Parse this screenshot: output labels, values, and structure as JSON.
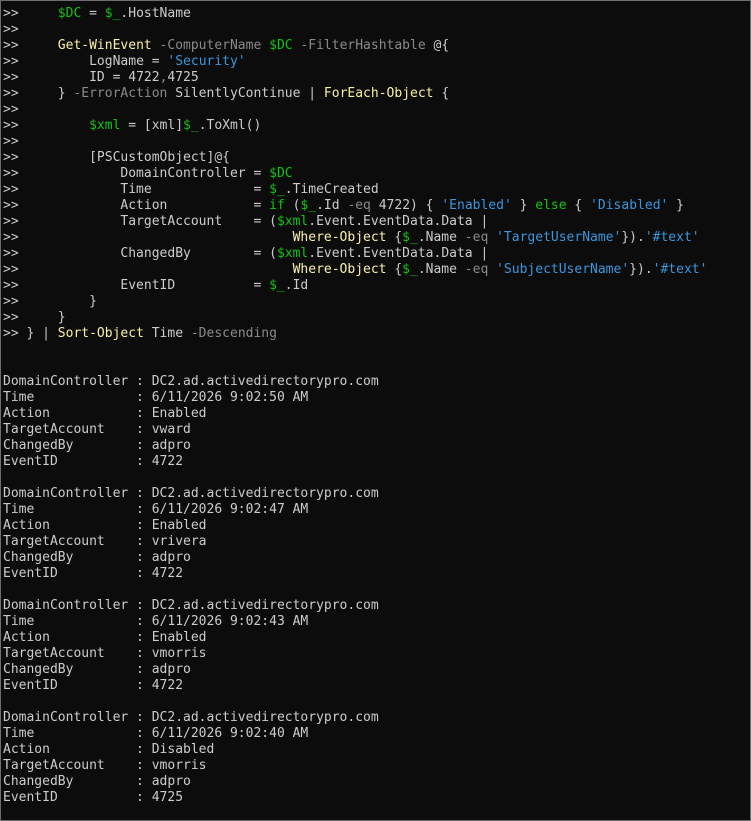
{
  "terminal": {
    "prompt": ">>",
    "code_lines": [
      {
        "indent": "     ",
        "tokens": [
          [
            "var",
            "$DC"
          ],
          [
            "txt",
            " = "
          ],
          [
            "var",
            "$_"
          ],
          [
            "txt",
            ".HostName"
          ]
        ]
      },
      {
        "indent": "",
        "tokens": []
      },
      {
        "indent": "     ",
        "tokens": [
          [
            "cmd",
            "Get-WinEvent"
          ],
          [
            "param",
            " -ComputerName "
          ],
          [
            "var",
            "$DC"
          ],
          [
            "param",
            " -FilterHashtable "
          ],
          [
            "txt",
            "@{"
          ]
        ]
      },
      {
        "indent": "         ",
        "tokens": [
          [
            "txt",
            "LogName = "
          ],
          [
            "str",
            "'Security'"
          ]
        ]
      },
      {
        "indent": "         ",
        "tokens": [
          [
            "txt",
            "ID = 4722"
          ],
          [
            "param",
            ","
          ],
          [
            "txt",
            "4725"
          ]
        ]
      },
      {
        "indent": "     ",
        "tokens": [
          [
            "txt",
            "} "
          ],
          [
            "param",
            "-ErrorAction "
          ],
          [
            "txt",
            "SilentlyContinue | "
          ],
          [
            "cmd",
            "ForEach-Object"
          ],
          [
            "txt",
            " {"
          ]
        ]
      },
      {
        "indent": "",
        "tokens": []
      },
      {
        "indent": "         ",
        "tokens": [
          [
            "var",
            "$xml"
          ],
          [
            "txt",
            " = [xml]"
          ],
          [
            "var",
            "$_"
          ],
          [
            "txt",
            ".ToXml()"
          ]
        ]
      },
      {
        "indent": "",
        "tokens": []
      },
      {
        "indent": "         ",
        "tokens": [
          [
            "txt",
            "[PSCustomObject]@{"
          ]
        ]
      },
      {
        "indent": "             ",
        "tokens": [
          [
            "txt",
            "DomainController = "
          ],
          [
            "var",
            "$DC"
          ]
        ]
      },
      {
        "indent": "             ",
        "tokens": [
          [
            "txt",
            "Time             = "
          ],
          [
            "var",
            "$_"
          ],
          [
            "txt",
            ".TimeCreated"
          ]
        ]
      },
      {
        "indent": "             ",
        "tokens": [
          [
            "txt",
            "Action           = "
          ],
          [
            "kw",
            "if"
          ],
          [
            "txt",
            " ("
          ],
          [
            "var",
            "$_"
          ],
          [
            "txt",
            ".Id "
          ],
          [
            "param",
            "-eq"
          ],
          [
            "txt",
            " 4722) { "
          ],
          [
            "str",
            "'Enabled'"
          ],
          [
            "txt",
            " } "
          ],
          [
            "kw",
            "else"
          ],
          [
            "txt",
            " { "
          ],
          [
            "str",
            "'Disabled'"
          ],
          [
            "txt",
            " }"
          ]
        ]
      },
      {
        "indent": "             ",
        "tokens": [
          [
            "txt",
            "TargetAccount    = ("
          ],
          [
            "var",
            "$xml"
          ],
          [
            "txt",
            ".Event.EventData.Data |"
          ]
        ]
      },
      {
        "indent": "                                   ",
        "tokens": [
          [
            "cmd",
            "Where-Object"
          ],
          [
            "txt",
            " {"
          ],
          [
            "var",
            "$_"
          ],
          [
            "txt",
            ".Name "
          ],
          [
            "param",
            "-eq"
          ],
          [
            "txt",
            " "
          ],
          [
            "str",
            "'TargetUserName'"
          ],
          [
            "txt",
            "})."
          ],
          [
            "str",
            "'#text'"
          ]
        ]
      },
      {
        "indent": "             ",
        "tokens": [
          [
            "txt",
            "ChangedBy        = ("
          ],
          [
            "var",
            "$xml"
          ],
          [
            "txt",
            ".Event.EventData.Data |"
          ]
        ]
      },
      {
        "indent": "                                   ",
        "tokens": [
          [
            "cmd",
            "Where-Object"
          ],
          [
            "txt",
            " {"
          ],
          [
            "var",
            "$_"
          ],
          [
            "txt",
            ".Name "
          ],
          [
            "param",
            "-eq"
          ],
          [
            "txt",
            " "
          ],
          [
            "str",
            "'SubjectUserName'"
          ],
          [
            "txt",
            "})."
          ],
          [
            "str",
            "'#text'"
          ]
        ]
      },
      {
        "indent": "             ",
        "tokens": [
          [
            "txt",
            "EventID          = "
          ],
          [
            "var",
            "$_"
          ],
          [
            "txt",
            ".Id"
          ]
        ]
      },
      {
        "indent": "         ",
        "tokens": [
          [
            "txt",
            "}"
          ]
        ]
      },
      {
        "indent": "     ",
        "tokens": [
          [
            "txt",
            "}"
          ]
        ]
      },
      {
        "indent": " ",
        "tokens": [
          [
            "txt",
            "} | "
          ],
          [
            "cmd",
            "Sort-Object"
          ],
          [
            "txt",
            " Time "
          ],
          [
            "param",
            "-Descending"
          ]
        ]
      }
    ],
    "output_records": [
      {
        "DomainController": "DC2.ad.activedirectorypro.com",
        "Time": "6/11/2026 9:02:50 AM",
        "Action": "Enabled",
        "TargetAccount": "vward",
        "ChangedBy": "adpro",
        "EventID": "4722"
      },
      {
        "DomainController": "DC2.ad.activedirectorypro.com",
        "Time": "6/11/2026 9:02:47 AM",
        "Action": "Enabled",
        "TargetAccount": "vrivera",
        "ChangedBy": "adpro",
        "EventID": "4722"
      },
      {
        "DomainController": "DC2.ad.activedirectorypro.com",
        "Time": "6/11/2026 9:02:43 AM",
        "Action": "Enabled",
        "TargetAccount": "vmorris",
        "ChangedBy": "adpro",
        "EventID": "4722"
      },
      {
        "DomainController": "DC2.ad.activedirectorypro.com",
        "Time": "6/11/2026 9:02:40 AM",
        "Action": "Disabled",
        "TargetAccount": "vmorris",
        "ChangedBy": "adpro",
        "EventID": "4725"
      }
    ],
    "field_labels": [
      "DomainController",
      "Time",
      "Action",
      "TargetAccount",
      "ChangedBy",
      "EventID"
    ],
    "field_separator": " : ",
    "colors": {
      "background": "#0c0c0c",
      "text": "#cccccc",
      "variable": "#13c313",
      "cmdlet": "#f9f1a5",
      "string": "#3a96dd",
      "parameter": "#8a8a8a"
    }
  }
}
